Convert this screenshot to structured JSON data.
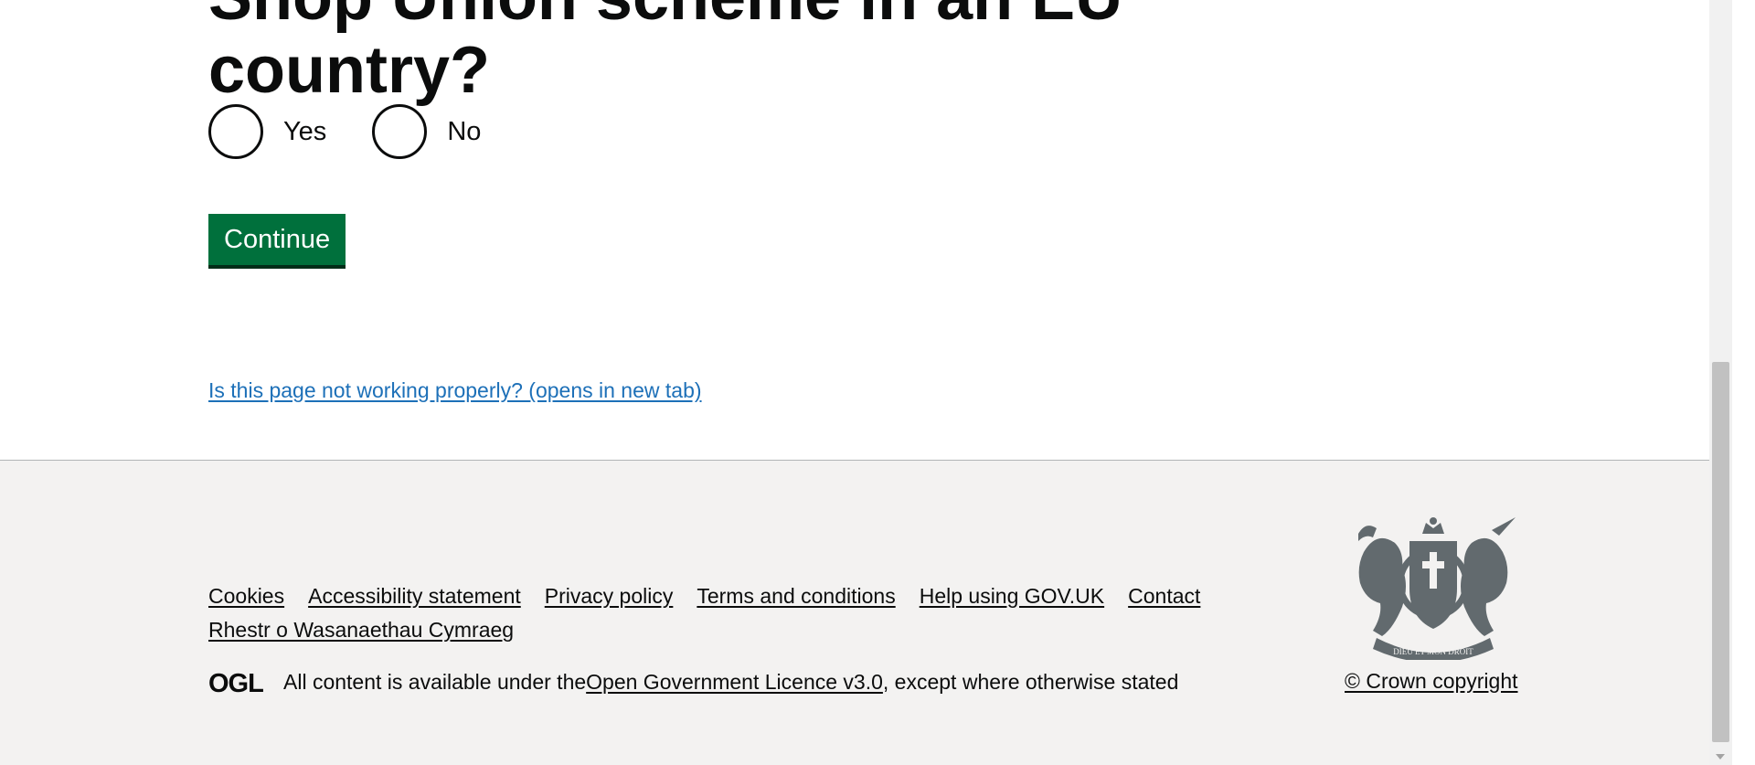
{
  "question": {
    "line1": "Shop Union scheme in an EU",
    "line2": "country?"
  },
  "radios": [
    {
      "label": "Yes",
      "checked": false
    },
    {
      "label": "No",
      "checked": false
    }
  ],
  "continue_label": "Continue",
  "feedback_link": "Is this page not working properly? (opens in new tab)",
  "footer": {
    "links": [
      "Cookies",
      "Accessibility statement",
      "Privacy policy",
      "Terms and conditions",
      "Help using GOV.UK",
      "Contact",
      "Rhestr o Wasanaethau Cymraeg"
    ],
    "licence_prefix": "All content is available under the ",
    "licence_link": "Open Government Licence v3.0",
    "licence_suffix": ", except where otherwise stated",
    "copyright": "© Crown copyright",
    "ogl_logo_text": "OGL",
    "crest_motto": "DIEU ET MON DROIT"
  },
  "colors": {
    "button_green": "#00703c",
    "link_blue": "#1d70b8",
    "footer_bg": "#f3f2f1",
    "crest_grey": "#626a6e"
  }
}
